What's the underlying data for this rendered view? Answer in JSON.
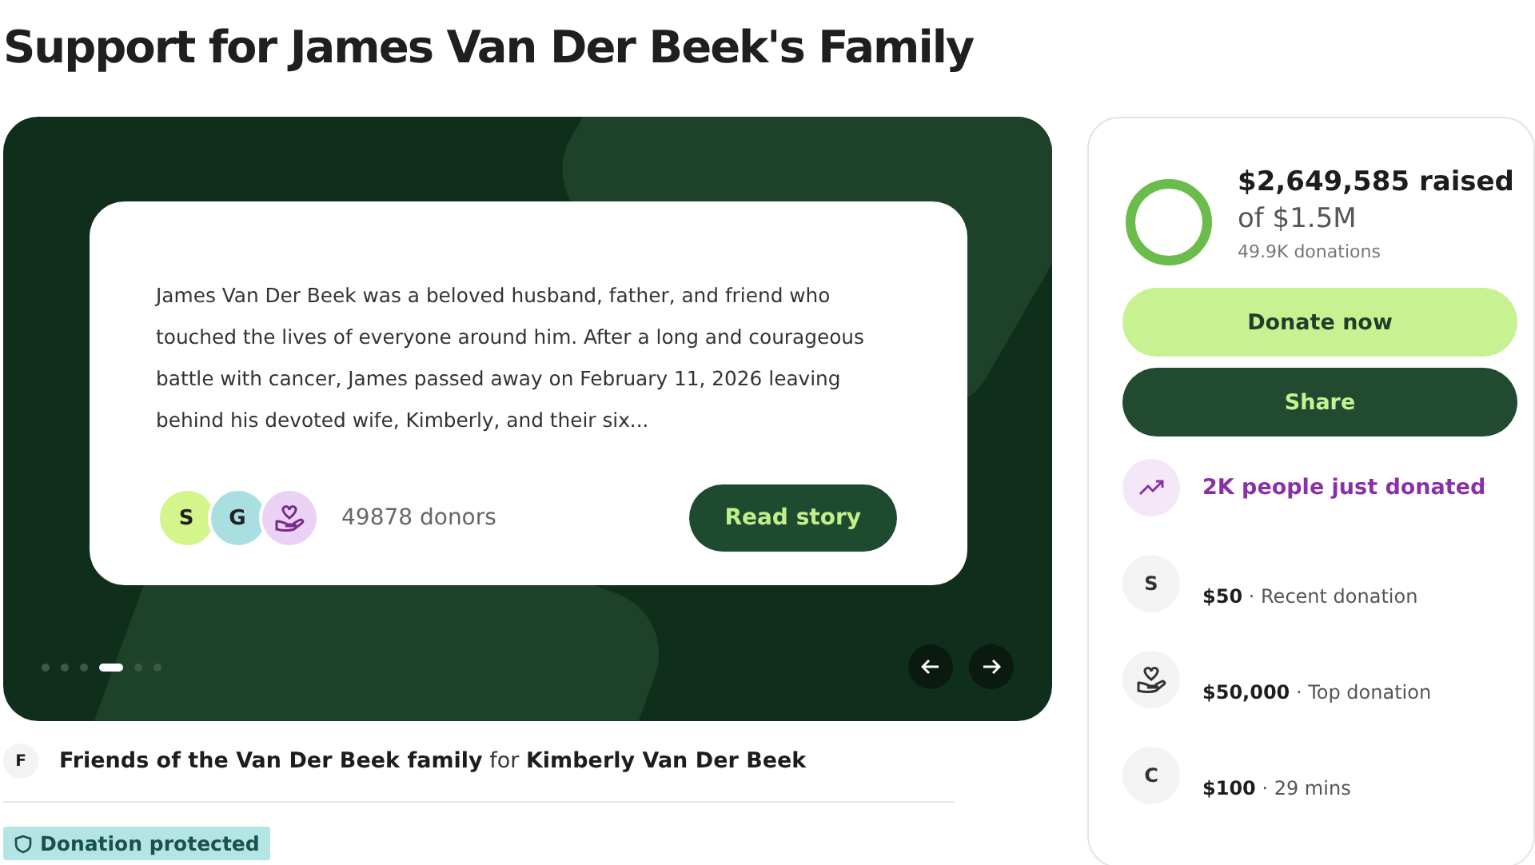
{
  "title": "Support for James Van Der Beek's Family",
  "carousel": {
    "story": "James Van Der Beek was a beloved husband, father, and friend who touched the lives of everyone around him. After a long and courageous battle with cancer, James passed away on February 11, 2026 leaving behind his devoted wife, Kimberly, and their six...",
    "donor_avatars": [
      {
        "kind": "letter",
        "letter": "S",
        "color": "#d4f48c"
      },
      {
        "kind": "letter",
        "letter": "G",
        "color": "#a9dfe0"
      },
      {
        "kind": "icon",
        "color": "#ead2f4"
      }
    ],
    "donor_count": "49878 donors",
    "read_button": "Read story",
    "dots": [
      {
        "selected": false
      },
      {
        "selected": false
      },
      {
        "selected": false
      },
      {
        "selected": true
      },
      {
        "selected": false
      },
      {
        "selected": false
      }
    ]
  },
  "organizer": {
    "initial": "F",
    "text": "**Friends of the Van Der Beek family** for **Kimberly Van Der Beek**"
  },
  "badge": "Donation protected",
  "sidebar": {
    "raised": "$2,649,585 raised",
    "goal": "of $1.5M",
    "donations": "49.9K donations",
    "level": 1,
    "donate_button": "Donate now",
    "share_button": "Share",
    "trend": "2K people just donated",
    "donors": [
      {
        "kind": "letter",
        "letter": "S",
        "amount": "$50",
        "note": "· Recent donation"
      },
      {
        "kind": "icon",
        "amount": "$50,000",
        "note": "· Top donation"
      },
      {
        "kind": "letter",
        "letter": "C",
        "amount": "$100",
        "note": "· 29 mins"
      }
    ]
  }
}
